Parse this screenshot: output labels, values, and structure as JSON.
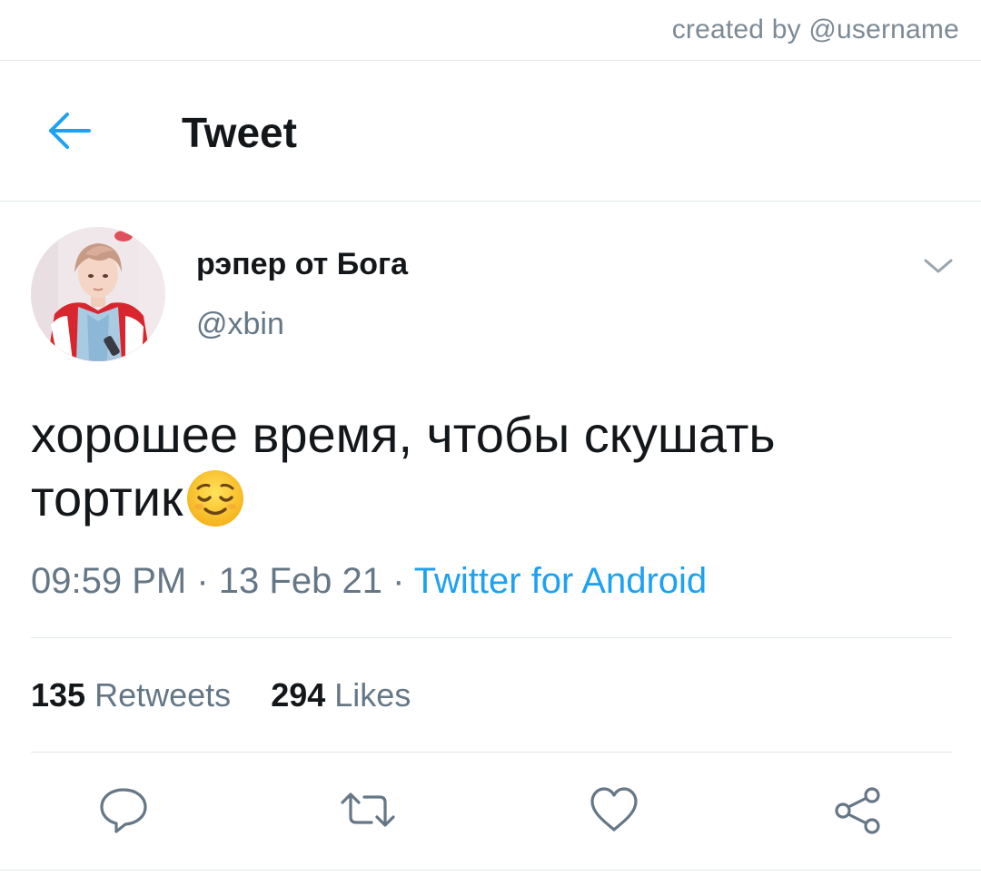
{
  "watermark": "created by @username",
  "header": {
    "title": "Tweet",
    "back_icon": "arrow-left-icon"
  },
  "tweet": {
    "author": {
      "display_name": "рэпер от Бога",
      "handle": "@xbin"
    },
    "text": "хорошее время, чтобы скушать тортик",
    "emoji": "relieved-face-emoji",
    "time": "09:59 PM",
    "date": "13 Feb 21",
    "separator": "·",
    "source": "Twitter for Android",
    "retweets_count": "135",
    "retweets_label": "Retweets",
    "likes_count": "294",
    "likes_label": "Likes"
  },
  "actions": [
    {
      "name": "reply",
      "icon": "reply-icon"
    },
    {
      "name": "retweet",
      "icon": "retweet-icon"
    },
    {
      "name": "like",
      "icon": "heart-icon"
    },
    {
      "name": "share",
      "icon": "share-icon"
    }
  ],
  "colors": {
    "accent": "#1da1f2",
    "secondary_text": "#657786",
    "primary_text": "#14171a",
    "divider": "#e1e8ed"
  }
}
